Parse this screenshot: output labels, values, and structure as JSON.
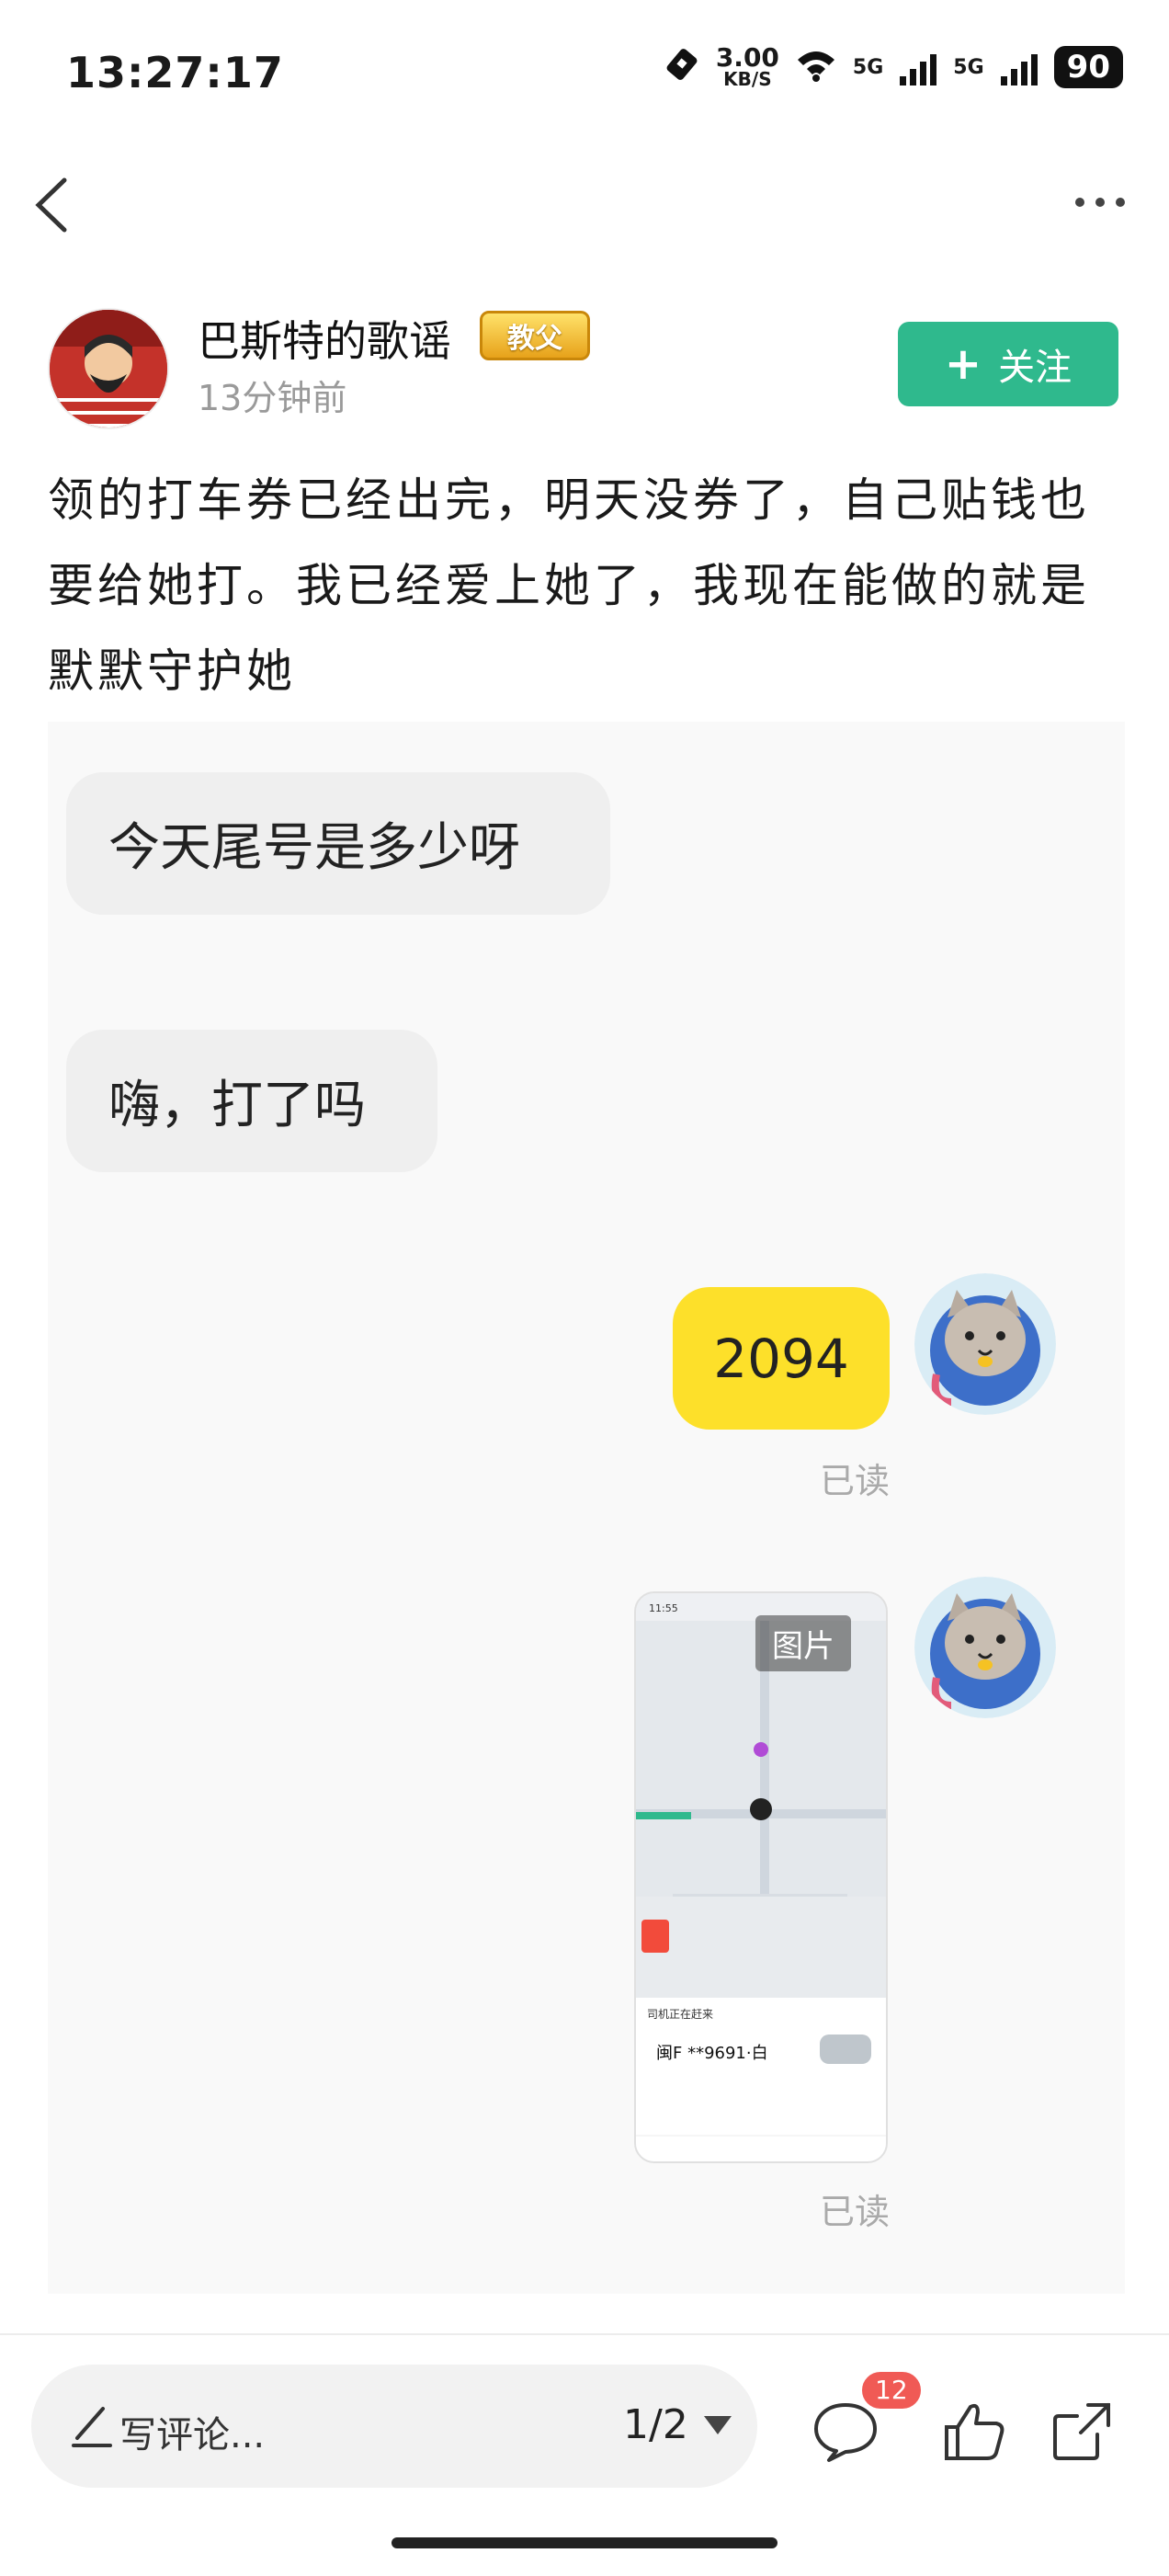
{
  "status_bar": {
    "time": "13:27:17",
    "speed_value": "3.00",
    "speed_unit": "KB/S",
    "net_1": "5G",
    "net_2": "5G",
    "battery": "90"
  },
  "post": {
    "author": "巴斯特的歌谣",
    "badge": "教父",
    "time_ago": "13分钟前",
    "follow_label": "关注",
    "text": "领的打车券已经出完，明天没券了，自己贴钱也要给她打。我已经爱上她了，我现在能做的就是默默守护她"
  },
  "chat": {
    "messages": [
      {
        "side": "left",
        "text": "今天尾号是多少呀"
      },
      {
        "side": "left",
        "text": "嗨，打了吗"
      },
      {
        "side": "right",
        "text": "2094",
        "status": "已读"
      },
      {
        "side": "right",
        "type": "image",
        "label": "图片",
        "status": "已读"
      }
    ],
    "thumbnail": {
      "time": "11:55",
      "plate": "闽F **9691·白",
      "status": "司机正在赶来"
    }
  },
  "bottom_bar": {
    "comment_placeholder": "写评论...",
    "page_indicator": "1/2",
    "comment_count": "12"
  },
  "colors": {
    "follow_green": "#2fb98d",
    "bubble_yellow": "#fde02a",
    "badge_red": "#f05a55"
  }
}
